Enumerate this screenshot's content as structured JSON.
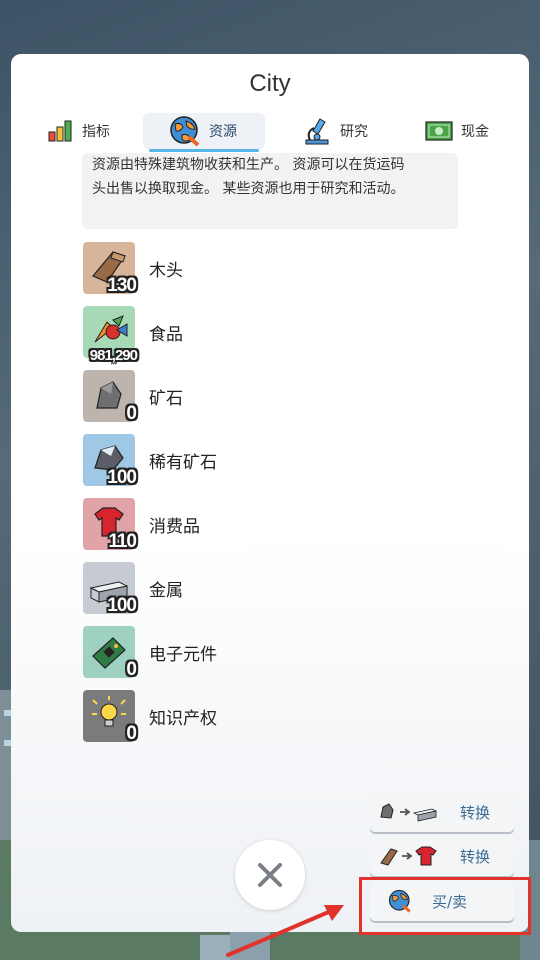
{
  "window": {
    "title": "City"
  },
  "tabs": [
    {
      "label": "指标",
      "icon": "bar-chart-icon"
    },
    {
      "label": "资源",
      "icon": "globe-icon",
      "active": true
    },
    {
      "label": "研究",
      "icon": "microscope-icon"
    },
    {
      "label": "现金",
      "icon": "cash-icon"
    }
  ],
  "description": {
    "line1": "资源由特殊建筑物收获和生产。 资源可以在货运码",
    "line2": "头出售以换取现金。 某些资源也用于研究和活动。"
  },
  "resources": [
    {
      "name": "木头",
      "count": "130",
      "icon": "wood-icon"
    },
    {
      "name": "食品",
      "count": "981,290",
      "icon": "food-icon"
    },
    {
      "name": "矿石",
      "count": "0",
      "icon": "ore-icon"
    },
    {
      "name": "稀有矿石",
      "count": "100",
      "icon": "rare-ore-icon"
    },
    {
      "name": "消费品",
      "count": "110",
      "icon": "consumer-goods-icon"
    },
    {
      "name": "金属",
      "count": "100",
      "icon": "metal-icon"
    },
    {
      "name": "电子元件",
      "count": "0",
      "icon": "electronics-icon"
    },
    {
      "name": "知识产权",
      "count": "0",
      "icon": "lightbulb-icon"
    }
  ],
  "actions": {
    "convert_ore_label": "转换",
    "convert_wood_label": "转换",
    "buy_sell_label": "买/卖"
  },
  "colors": {
    "accent": "#59b6e8",
    "highlight": "#e0332c",
    "action_text": "#3a6a96"
  }
}
